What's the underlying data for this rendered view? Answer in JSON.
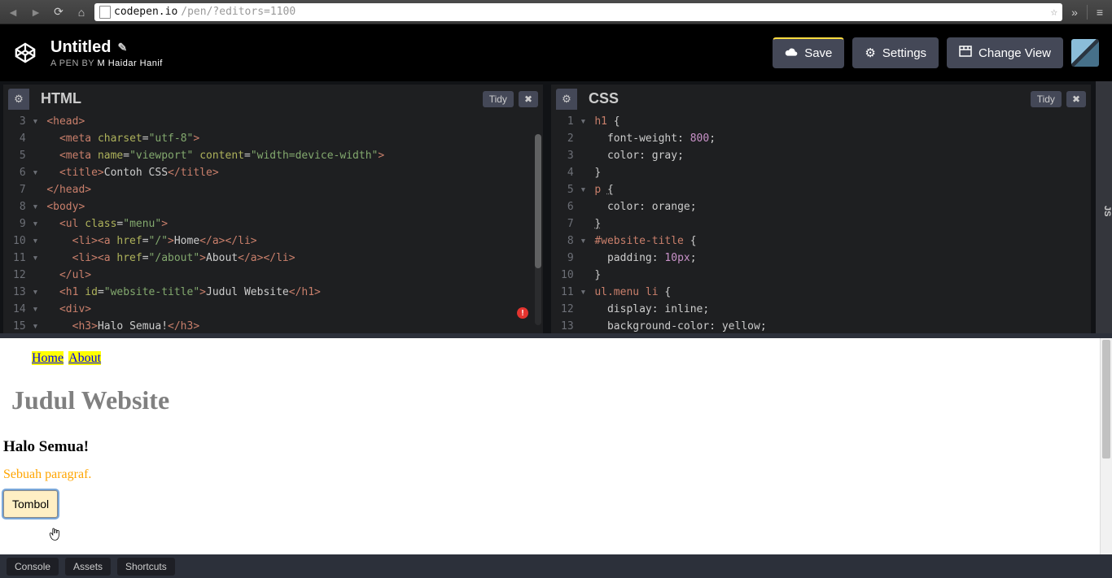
{
  "browser": {
    "url_host": "codepen.io",
    "url_path": "/pen/?editors=1100"
  },
  "header": {
    "title": "Untitled",
    "pen_by_label": "A PEN BY ",
    "author": "M Haidar Hanif",
    "buttons": {
      "save": "Save",
      "settings": "Settings",
      "change_view": "Change View"
    }
  },
  "panels": {
    "html": {
      "label": "HTML",
      "tidy": "Tidy",
      "gutter": " 3 ▾\n 4  \n 5  \n 6 ▾\n 7  \n 8 ▾\n 9 ▾\n10 ▾\n11 ▾\n12  \n13 ▾\n14 ▾\n15 ▾"
    },
    "css": {
      "label": "CSS",
      "tidy": "Tidy",
      "gutter": " 1 ▾\n 2  \n 3  \n 4  \n 5 ▾\n 6  \n 7  \n 8 ▾\n 9  \n10  \n11 ▾\n12  \n13  "
    },
    "js_label": "JS"
  },
  "html_code": {
    "l3": {
      "a": "<head>"
    },
    "l4": {
      "a": "  <meta ",
      "b": "charset",
      "c": "=",
      "d": "\"utf-8\"",
      "e": ">"
    },
    "l5": {
      "a": "  <meta ",
      "b": "name",
      "c": "=",
      "d": "\"viewport\"",
      "e": " ",
      "f": "content",
      "g": "=",
      "h": "\"width=device-width\"",
      "i": ">"
    },
    "l6": {
      "a": "  <title>",
      "b": "Contoh CSS",
      "c": "</title>"
    },
    "l7": {
      "a": "</head>"
    },
    "l8": {
      "a": "<body>"
    },
    "l9": {
      "a": "  <ul ",
      "b": "class",
      "c": "=",
      "d": "\"menu\"",
      "e": ">"
    },
    "l10": {
      "a": "    <li><a ",
      "b": "href",
      "c": "=",
      "d": "\"/\"",
      "e": ">",
      "f": "Home",
      "g": "</a></li>"
    },
    "l11": {
      "a": "    <li><a ",
      "b": "href",
      "c": "=",
      "d": "\"/about\"",
      "e": ">",
      "f": "About",
      "g": "</a></li>"
    },
    "l12": {
      "a": "  </ul>"
    },
    "l13": {
      "a": "  <h1 ",
      "b": "id",
      "c": "=",
      "d": "\"website-title\"",
      "e": ">",
      "f": "Judul Website",
      "g": "</h1>"
    },
    "l14": {
      "a": "  <div>"
    },
    "l15": {
      "a": "    <h3>",
      "b": "Halo Semua!",
      "c": "</h3>"
    }
  },
  "css_code": {
    "l1": {
      "a": "h1 ",
      "b": "{"
    },
    "l2": {
      "a": "  ",
      "b": "font-weight",
      "c": ": ",
      "d": "800",
      "e": ";"
    },
    "l3": {
      "a": "  ",
      "b": "color",
      "c": ": ",
      "d": "gray",
      "e": ";"
    },
    "l4": {
      "a": "}"
    },
    "l5": {
      "a": "p ",
      "b": "{"
    },
    "l6": {
      "a": "  ",
      "b": "color",
      "c": ": ",
      "d": "orange",
      "e": ";"
    },
    "l7": {
      "a": "}"
    },
    "l8": {
      "a": "#website-title ",
      "b": "{"
    },
    "l9": {
      "a": "  ",
      "b": "padding",
      "c": ": ",
      "d": "10px",
      "e": ";"
    },
    "l10": {
      "a": "}"
    },
    "l11": {
      "a": "ul.menu li ",
      "b": "{"
    },
    "l12": {
      "a": "  ",
      "b": "display",
      "c": ": ",
      "d": "inline",
      "e": ";"
    },
    "l13": {
      "a": "  ",
      "b": "background-color",
      "c": ": ",
      "d": "yellow",
      "e": ";"
    }
  },
  "preview": {
    "nav_home": "Home",
    "nav_about": "About",
    "h1": "Judul Website",
    "h3": "Halo Semua!",
    "p": "Sebuah paragraf.",
    "button": "Tombol"
  },
  "footer": {
    "console": "Console",
    "assets": "Assets",
    "shortcuts": "Shortcuts"
  }
}
